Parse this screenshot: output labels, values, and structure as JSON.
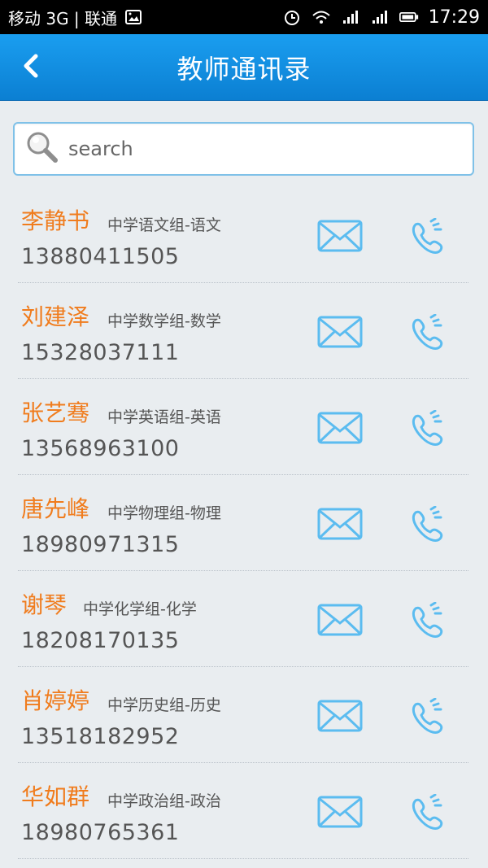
{
  "status_bar": {
    "left_text": "移动 3G | 联通",
    "time": "17:29"
  },
  "header": {
    "title": "教师通讯录"
  },
  "search": {
    "placeholder": "search"
  },
  "contacts": [
    {
      "name": "李静书",
      "group": "中学语文组-语文",
      "phone": "13880411505"
    },
    {
      "name": "刘建泽",
      "group": "中学数学组-数学",
      "phone": "15328037111"
    },
    {
      "name": "张艺骞",
      "group": "中学英语组-英语",
      "phone": "13568963100"
    },
    {
      "name": "唐先峰",
      "group": "中学物理组-物理",
      "phone": "18980971315"
    },
    {
      "name": "谢琴",
      "group": "中学化学组-化学",
      "phone": "18208170135"
    },
    {
      "name": "肖婷婷",
      "group": "中学历史组-历史",
      "phone": "13518182952"
    },
    {
      "name": "华如群",
      "group": "中学政治组-政治",
      "phone": "18980765361"
    }
  ],
  "colors": {
    "header_blue": "#1a9ef0",
    "name_orange": "#f07c1d",
    "icon_blue": "#5bbcf0"
  }
}
